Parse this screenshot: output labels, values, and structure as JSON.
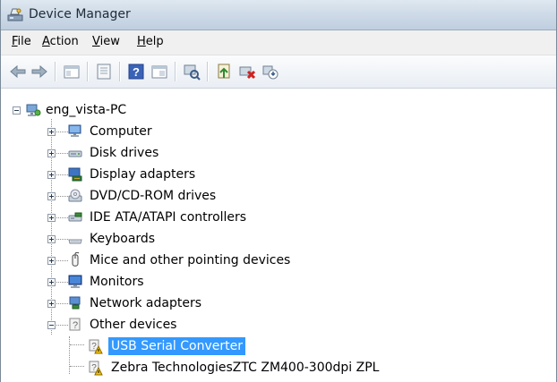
{
  "window": {
    "title": "Device Manager"
  },
  "menu": [
    "File",
    "Action",
    "View",
    "Help"
  ],
  "menu_access_keys": [
    "F",
    "A",
    "V",
    "H"
  ],
  "toolbar": {
    "buttons": [
      "back-icon",
      "forward-icon",
      "properties-pane-icon",
      "properties-icon",
      "help-icon",
      "console-tree-icon",
      "scan-hardware-icon",
      "update-driver-icon",
      "uninstall-icon",
      "disable-icon"
    ]
  },
  "tree": {
    "root": "eng_vista-PC",
    "categories": [
      {
        "label": "Computer",
        "icon": "computer-icon"
      },
      {
        "label": "Disk drives",
        "icon": "disk-drive-icon"
      },
      {
        "label": "Display adapters",
        "icon": "display-adapter-icon"
      },
      {
        "label": "DVD/CD-ROM drives",
        "icon": "dvd-drive-icon"
      },
      {
        "label": "IDE ATA/ATAPI controllers",
        "icon": "ide-controller-icon"
      },
      {
        "label": "Keyboards",
        "icon": "keyboard-icon"
      },
      {
        "label": "Mice and other pointing devices",
        "icon": "mouse-icon"
      },
      {
        "label": "Monitors",
        "icon": "monitor-icon"
      },
      {
        "label": "Network adapters",
        "icon": "network-adapter-icon"
      },
      {
        "label": "Other devices",
        "icon": "unknown-device-icon"
      }
    ],
    "other_devices": [
      {
        "label": "USB Serial Converter",
        "selected": true
      },
      {
        "label": "Zebra TechnologiesZTC ZM400-300dpi ZPL",
        "selected": false
      }
    ]
  }
}
